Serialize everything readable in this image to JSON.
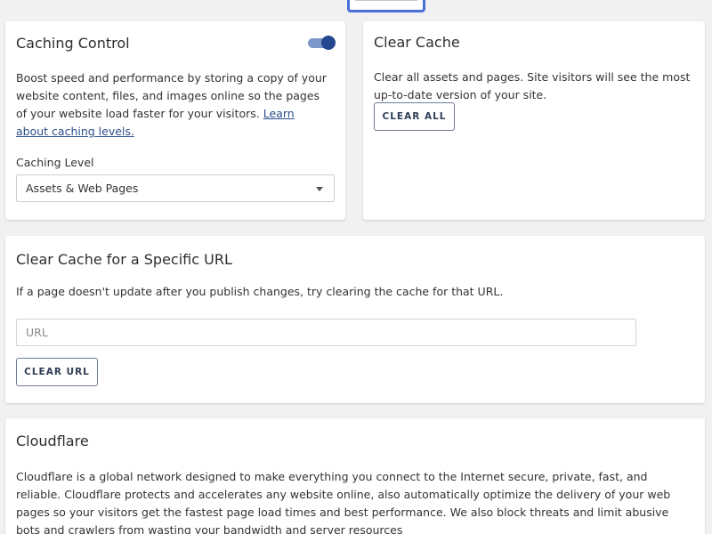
{
  "caching_control": {
    "title": "Caching Control",
    "toggle_on": true,
    "description": "Boost speed and performance by storing a copy of your website content, files, and images online so the pages of your website load faster for your visitors.",
    "learn_link": "Learn about caching levels.",
    "level_label": "Caching Level",
    "level_value": "Assets & Web Pages"
  },
  "clear_cache": {
    "title": "Clear Cache",
    "description": "Clear all assets and pages. Site visitors will see the most up-to-date version of your site.",
    "button_label": "CLEAR ALL"
  },
  "clear_url": {
    "title": "Clear Cache for a Specific URL",
    "description": "If a page doesn't update after you publish changes, try clearing the cache for that URL.",
    "input_placeholder": "URL",
    "button_label": "CLEAR URL"
  },
  "cloudflare": {
    "title": "Cloudflare",
    "description": "Cloudflare is a global network designed to make everything you connect to the Internet secure, private, fast, and reliable. Cloudflare protects and accelerates any website online, also automatically optimize the delivery of your web pages so your visitors get the fastest page load times and best performance. We also block threats and limit abusive bots and crawlers from wasting your bandwidth and server resources"
  },
  "colors": {
    "accent": "#23468f",
    "toggle_track": "#7b97c9",
    "link": "#2c4f8c",
    "page_bg": "#f1f1f1"
  }
}
